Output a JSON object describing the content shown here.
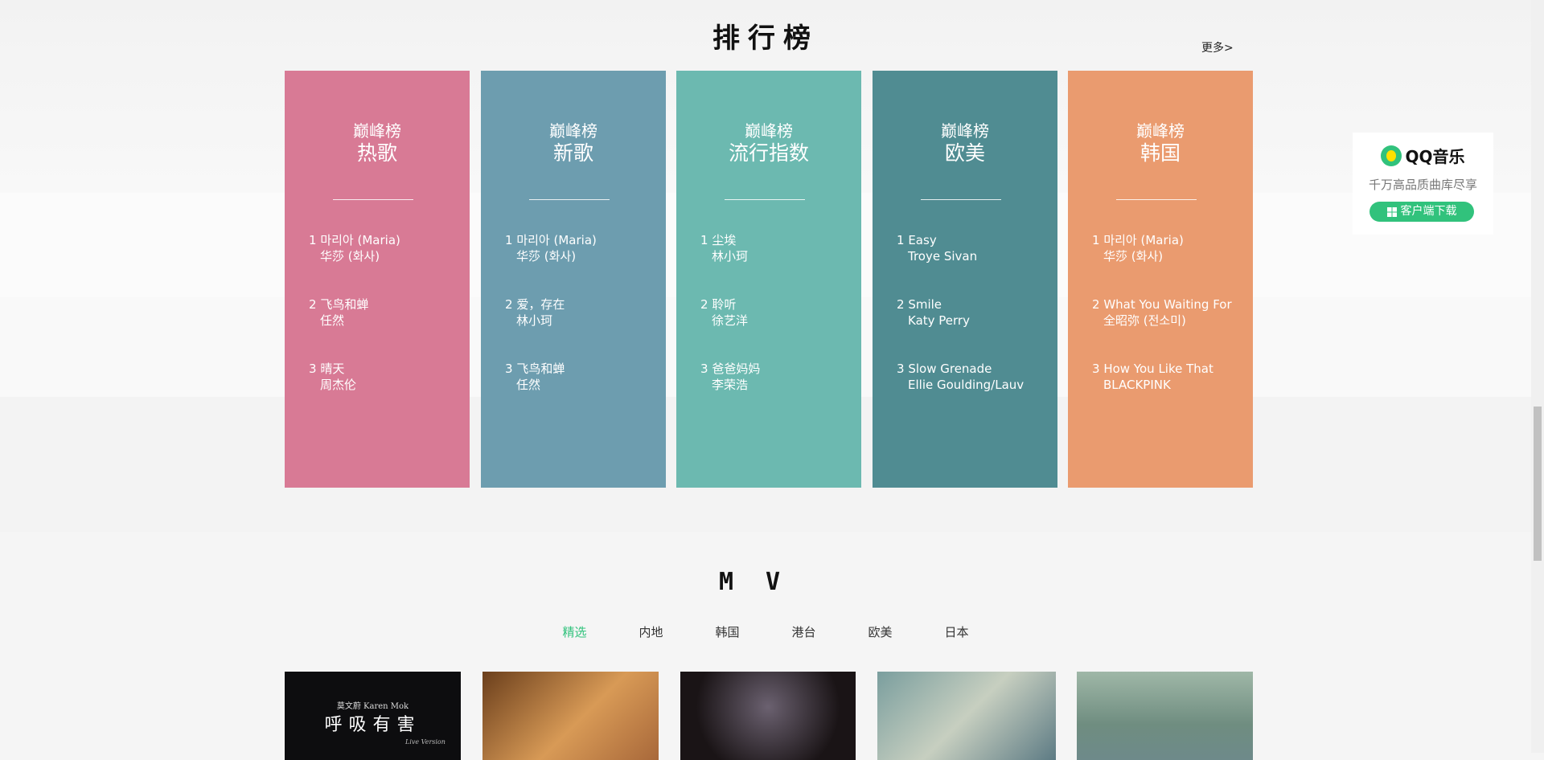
{
  "ranking": {
    "title": "排行榜",
    "more_label": "更多>",
    "cards": [
      {
        "subtitle": "巅峰榜",
        "name": "热歌",
        "color": "#d87a95",
        "songs": [
          {
            "rank": "1",
            "title": "마리아 (Maria)",
            "artist": "华莎 (화사)"
          },
          {
            "rank": "2",
            "title": "飞鸟和蝉",
            "artist": "任然"
          },
          {
            "rank": "3",
            "title": "晴天",
            "artist": "周杰伦"
          }
        ]
      },
      {
        "subtitle": "巅峰榜",
        "name": "新歌",
        "color": "#6d9daf",
        "songs": [
          {
            "rank": "1",
            "title": "마리아 (Maria)",
            "artist": "华莎 (화사)"
          },
          {
            "rank": "2",
            "title": "爱，存在",
            "artist": "林小珂"
          },
          {
            "rank": "3",
            "title": "飞鸟和蝉",
            "artist": "任然"
          }
        ]
      },
      {
        "subtitle": "巅峰榜",
        "name": "流行指数",
        "color": "#6cb9b0",
        "songs": [
          {
            "rank": "1",
            "title": "尘埃",
            "artist": "林小珂"
          },
          {
            "rank": "2",
            "title": "聆听",
            "artist": "徐艺洋"
          },
          {
            "rank": "3",
            "title": "爸爸妈妈",
            "artist": "李荣浩"
          }
        ]
      },
      {
        "subtitle": "巅峰榜",
        "name": "欧美",
        "color": "#508c92",
        "songs": [
          {
            "rank": "1",
            "title": "Easy",
            "artist": "Troye Sivan"
          },
          {
            "rank": "2",
            "title": "Smile",
            "artist": "Katy Perry"
          },
          {
            "rank": "3",
            "title": "Slow Grenade",
            "artist": "Ellie Goulding/Lauv"
          }
        ]
      },
      {
        "subtitle": "巅峰榜",
        "name": "韩国",
        "color": "#ea9b6f",
        "songs": [
          {
            "rank": "1",
            "title": "마리아 (Maria)",
            "artist": "华莎 (화사)"
          },
          {
            "rank": "2",
            "title": "What You Waiting For",
            "artist": "全昭弥 (전소미)"
          },
          {
            "rank": "3",
            "title": "How You Like That",
            "artist": "BLACKPINK"
          }
        ]
      }
    ]
  },
  "qq_widget": {
    "brand": "QQ音乐",
    "slogan": "千万高品质曲库尽享",
    "download_label": "客户端下载",
    "accent": "#31c27c"
  },
  "mv": {
    "title": "MV",
    "tabs": [
      "精选",
      "内地",
      "韩国",
      "港台",
      "欧美",
      "日本"
    ],
    "active_tab": 0,
    "first_thumb": {
      "artist": "莫文蔚",
      "artist_en": "Karen Mok",
      "title": "呼吸有害",
      "sub": "Live Version"
    }
  }
}
